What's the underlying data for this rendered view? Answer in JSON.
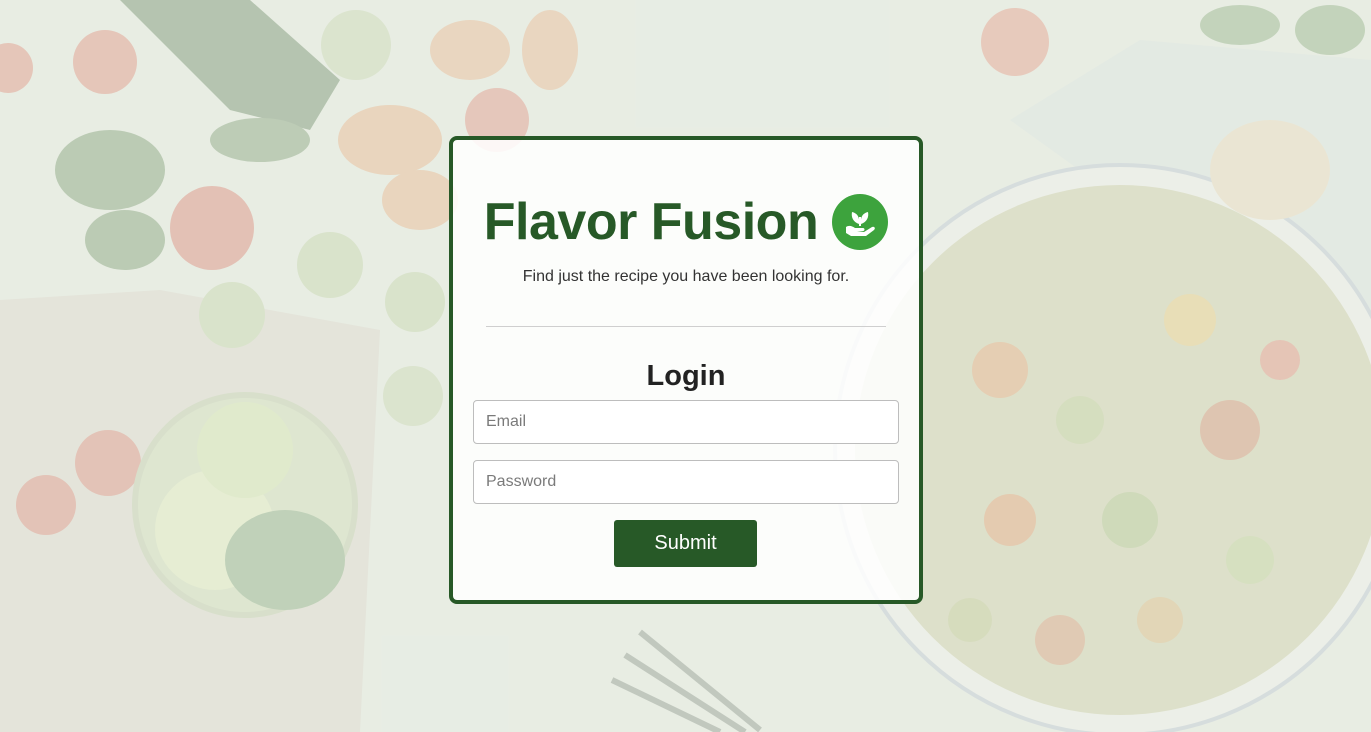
{
  "brand": {
    "title": "Flavor Fusion",
    "logo_icon": "hand-sprout-icon",
    "logo_color": "#3da33d",
    "title_color": "#275927"
  },
  "tagline": "Find just the recipe you have been looking for.",
  "login": {
    "heading": "Login",
    "email_placeholder": "Email",
    "password_placeholder": "Password",
    "submit_label": "Submit"
  },
  "theme": {
    "primary": "#275927",
    "card_border": "#275927"
  }
}
